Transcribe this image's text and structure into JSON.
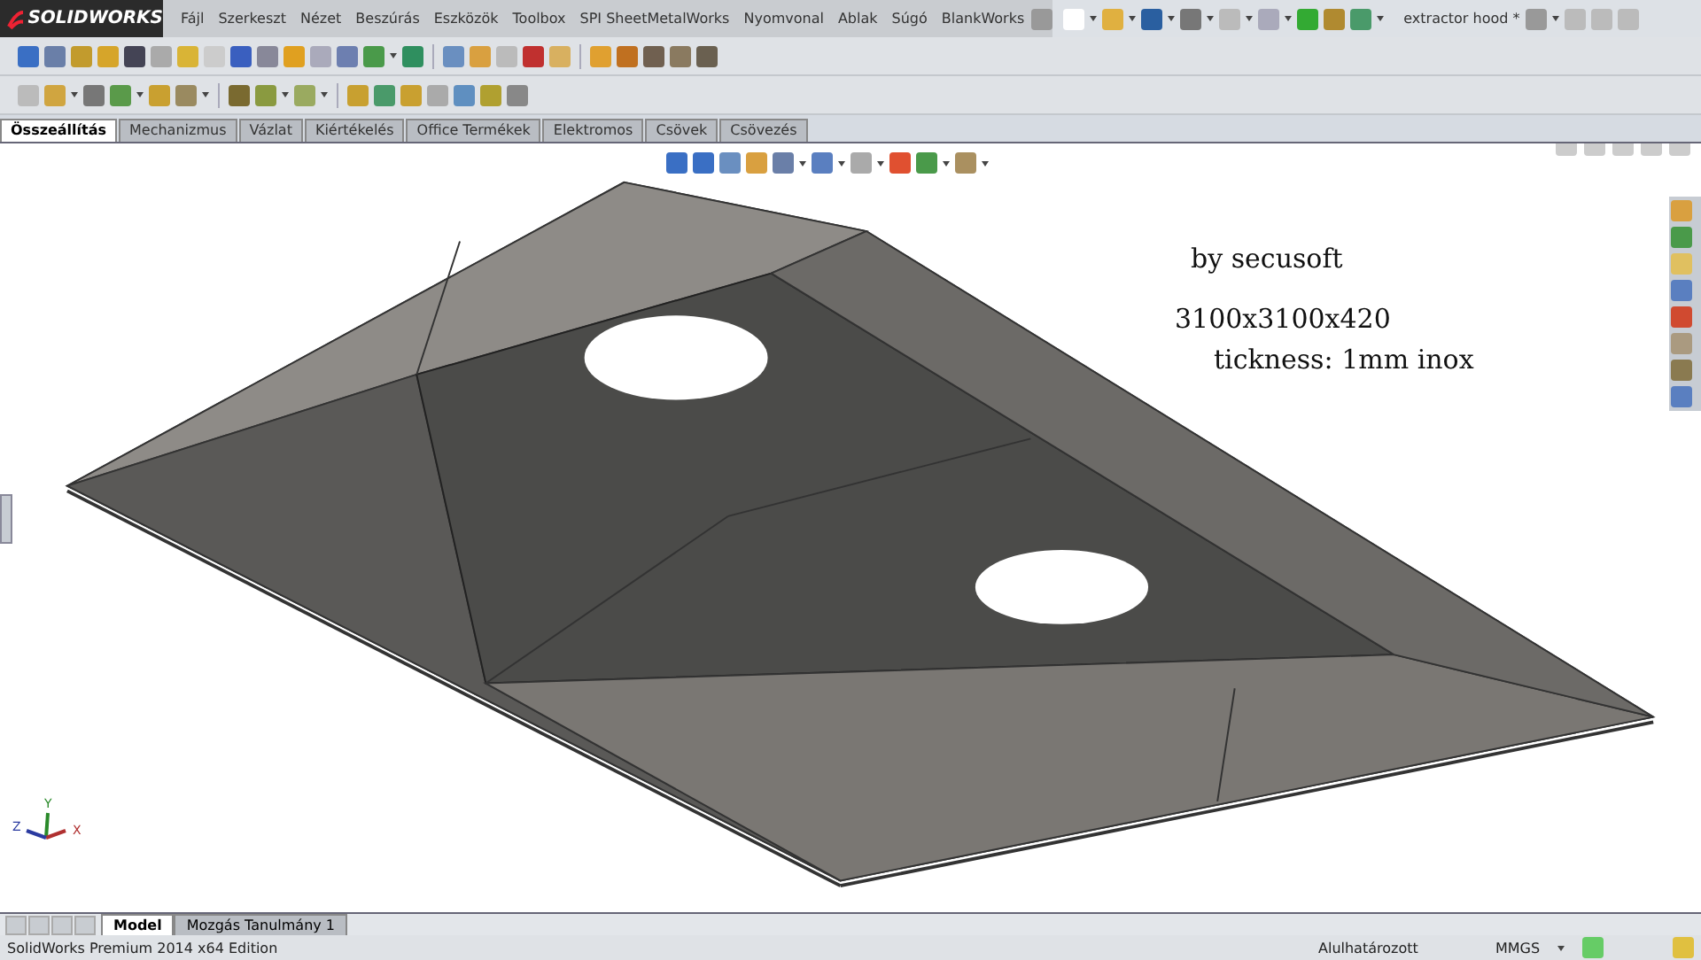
{
  "app": {
    "logo": "SOLIDWORKS",
    "menu": [
      "Fájl",
      "Szerkeszt",
      "Nézet",
      "Beszúrás",
      "Eszközök",
      "Toolbox",
      "SPI SheetMetalWorks",
      "Nyomvonal",
      "Ablak",
      "Súgó",
      "BlankWorks"
    ],
    "document_title": "extractor hood *"
  },
  "command_tabs": [
    {
      "label": "Összeállítás",
      "selected": true
    },
    {
      "label": "Mechanizmus",
      "selected": false
    },
    {
      "label": "Vázlat",
      "selected": false
    },
    {
      "label": "Kiértékelés",
      "selected": false
    },
    {
      "label": "Office Termékek",
      "selected": false
    },
    {
      "label": "Elektromos",
      "selected": false
    },
    {
      "label": "Csövek",
      "selected": false
    },
    {
      "label": "Csövezés",
      "selected": false
    }
  ],
  "viewport": {
    "notes": [
      "by secusoft",
      "3100x3100x420",
      "tickness: 1mm inox"
    ],
    "triad": {
      "x": "X",
      "y": "Y",
      "z": "Z"
    }
  },
  "bottom_tabs": [
    {
      "label": "Model",
      "selected": true
    },
    {
      "label": "Mozgás Tanulmány 1",
      "selected": false
    }
  ],
  "status_bar": {
    "edition": "SolidWorks Premium 2014 x64 Edition",
    "state": "Alulhatározott",
    "units": "MMGS"
  }
}
